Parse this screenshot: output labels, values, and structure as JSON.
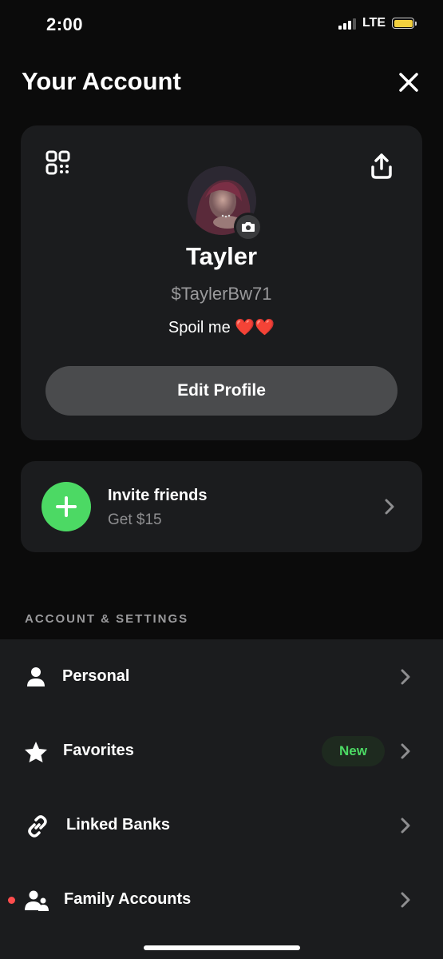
{
  "status_bar": {
    "time": "2:00",
    "network": "LTE",
    "battery_color": "#f2d03e"
  },
  "header": {
    "title": "Your Account",
    "close_icon": "close-icon"
  },
  "profile": {
    "qr_icon": "qr-code-icon",
    "share_icon": "share-icon",
    "camera_icon": "camera-icon",
    "name": "Tayler",
    "cashtag": "$TaylerBw71",
    "bio_text": "Spoil me",
    "bio_emoji": "❤️❤️",
    "edit_button_label": "Edit Profile"
  },
  "invite": {
    "title": "Invite friends",
    "subtitle": "Get $15",
    "accent_color": "#4cd964"
  },
  "settings": {
    "section_title": "ACCOUNT & SETTINGS",
    "items": [
      {
        "label": "Personal",
        "icon": "person-icon"
      },
      {
        "label": "Favorites",
        "icon": "star-icon",
        "badge": "New"
      },
      {
        "label": "Linked Banks",
        "icon": "link-icon"
      },
      {
        "label": "Family Accounts",
        "icon": "family-icon",
        "notification": true
      }
    ]
  }
}
